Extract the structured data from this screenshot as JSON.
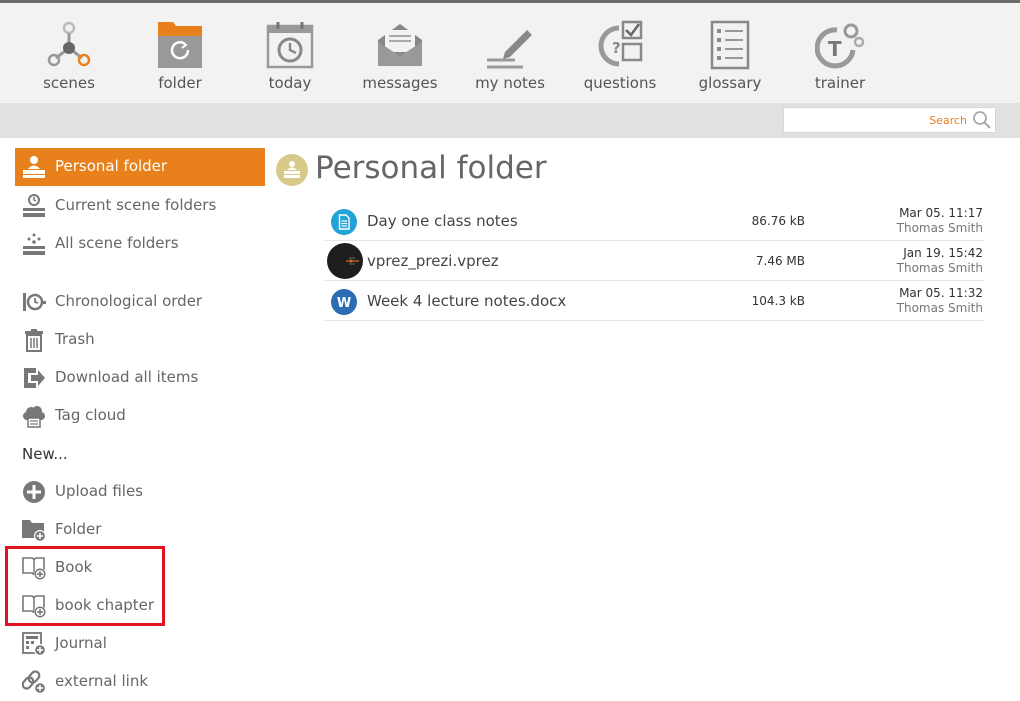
{
  "topnav": {
    "items": [
      {
        "label": "scenes",
        "icon": "scenes-icon"
      },
      {
        "label": "folder",
        "icon": "folder-icon"
      },
      {
        "label": "today",
        "icon": "calendar-icon"
      },
      {
        "label": "messages",
        "icon": "envelope-icon"
      },
      {
        "label": "my notes",
        "icon": "pencil-icon"
      },
      {
        "label": "questions",
        "icon": "questions-icon"
      },
      {
        "label": "glossary",
        "icon": "glossary-icon"
      },
      {
        "label": "trainer",
        "icon": "trainer-icon"
      }
    ]
  },
  "search": {
    "label": "Search",
    "icon": "magnifier-icon"
  },
  "sidebar": {
    "items": [
      {
        "label": "Personal folder",
        "icon": "user-folder-icon",
        "active": true
      },
      {
        "label": "Current scene folders",
        "icon": "clock-folder-icon"
      },
      {
        "label": "All scene folders",
        "icon": "scatter-folder-icon"
      },
      {
        "label": "Chronological order",
        "icon": "timeline-icon"
      },
      {
        "label": "Trash",
        "icon": "trash-icon"
      },
      {
        "label": "Download all items",
        "icon": "download-icon"
      },
      {
        "label": "Tag cloud",
        "icon": "tag-cloud-icon"
      }
    ],
    "new_heading": "New...",
    "new_items": [
      {
        "label": "Upload files",
        "icon": "plus-circle-icon"
      },
      {
        "label": "Folder",
        "icon": "new-folder-icon"
      },
      {
        "label": "Book",
        "icon": "book-add-icon"
      },
      {
        "label": "book chapter",
        "icon": "book-add-icon"
      },
      {
        "label": "Journal",
        "icon": "journal-add-icon"
      },
      {
        "label": "external link",
        "icon": "link-add-icon"
      }
    ]
  },
  "main": {
    "title": "Personal folder",
    "files": [
      {
        "name": "Day one class notes",
        "size": "86.76 kB",
        "date": "Mar 05. 11:17",
        "owner": "Thomas Smith",
        "icon": "document-icon",
        "icon_color": "#22a4d6"
      },
      {
        "name": "vprez_prezi.vprez",
        "size": "7.46 MB",
        "date": "Jan 19. 15:42",
        "owner": "Thomas Smith",
        "icon": "prezi-thumbnail-icon",
        "icon_color": "#1e1e1e"
      },
      {
        "name": "Week 4 lecture notes.docx",
        "size": "104.3 kB",
        "date": "Mar 05. 11:32",
        "owner": "Thomas Smith",
        "icon": "word-icon",
        "icon_color": "#2b6cb3",
        "icon_letter": "W"
      }
    ]
  },
  "colors": {
    "accent": "#e8811c",
    "highlight": "#e0141e",
    "icon_gray": "#7a7a7a"
  }
}
